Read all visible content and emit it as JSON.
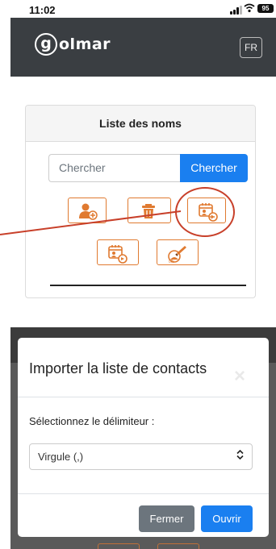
{
  "status_bar": {
    "time": "11:02",
    "battery": "95"
  },
  "header": {
    "logo_letter": "g",
    "logo_text": "olmar",
    "language_button": "FR"
  },
  "card": {
    "title": "Liste des noms",
    "search": {
      "placeholder": "Chercher",
      "button_label": "Chercher"
    },
    "action_icons": [
      "add-contact-icon",
      "delete-icon",
      "import-contacts-icon",
      "export-contacts-icon",
      "erase-memory-icon"
    ]
  },
  "modal": {
    "title": "Importer la liste de contacts",
    "close_glyph": "×",
    "delimiter_label": "Sélectionnez le délimiteur :",
    "delimiter_selected": "Virgule (,)",
    "close_button": "Fermer",
    "open_button": "Ouvrir"
  },
  "colors": {
    "primary": "#1a7ff0",
    "header_dark": "#3a3e42",
    "icon_orange": "#e07a30",
    "highlight_red": "#c8402a",
    "secondary": "#6c757d"
  }
}
